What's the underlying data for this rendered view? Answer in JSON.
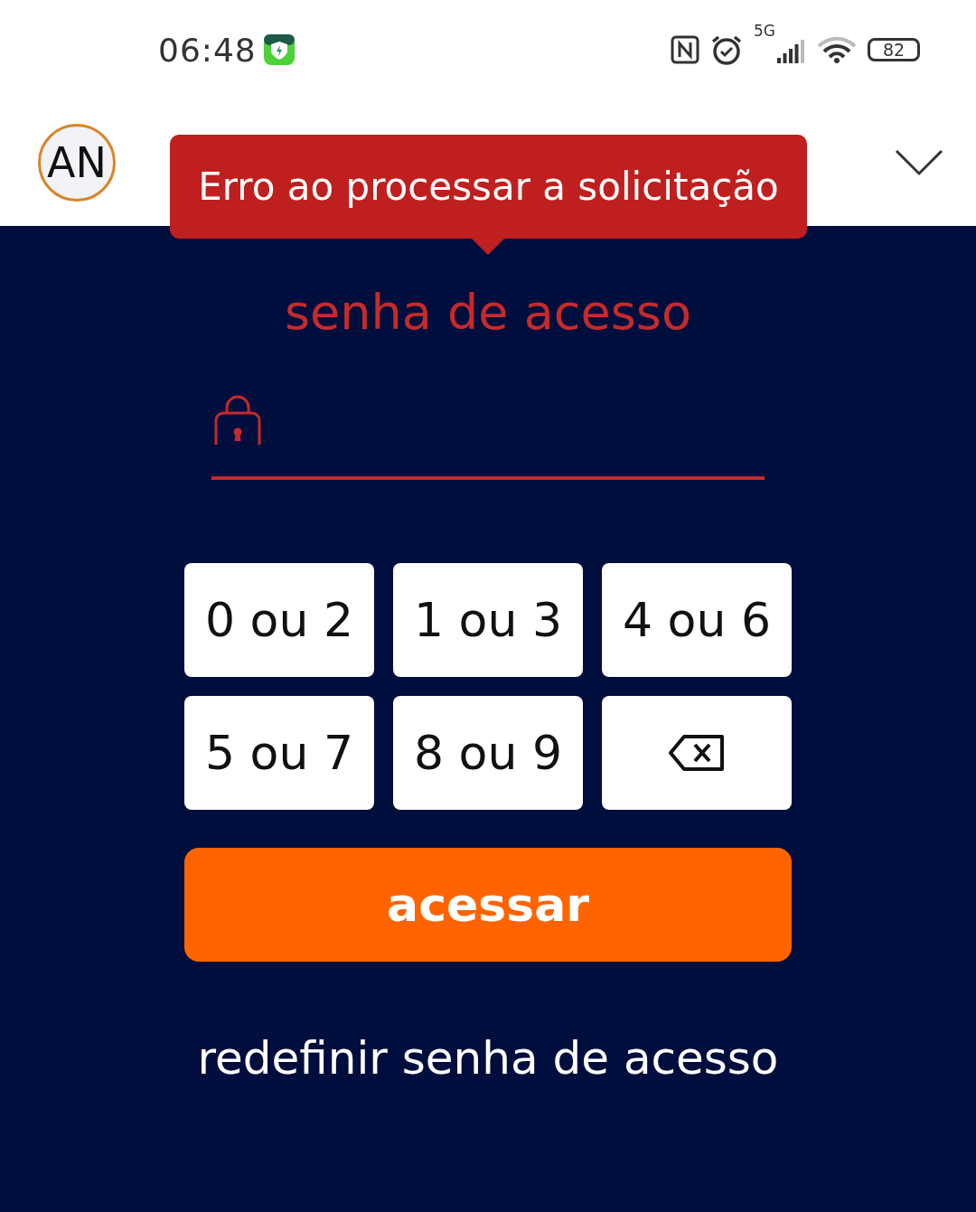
{
  "status_bar": {
    "time": "06:48",
    "network": "5G",
    "battery": "82"
  },
  "header": {
    "avatar": "AN"
  },
  "tooltip": {
    "message": "Erro ao processar a solicitação"
  },
  "title": "senha de acesso",
  "keypad": [
    {
      "kind": "digits",
      "label": "0 ou 2"
    },
    {
      "kind": "digits",
      "label": "1 ou 3"
    },
    {
      "kind": "digits",
      "label": "4 ou 6"
    },
    {
      "kind": "digits",
      "label": "5 ou 7"
    },
    {
      "kind": "digits",
      "label": "8 ou 9"
    },
    {
      "kind": "backspace"
    }
  ],
  "submit": "acessar",
  "reset_link": "redefinir senha de acesso"
}
